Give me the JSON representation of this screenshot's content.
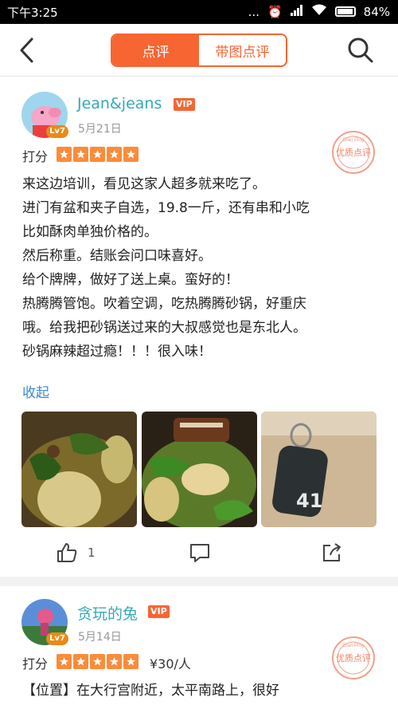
{
  "status": {
    "time": "下午3:25",
    "dots": "...",
    "battery": "84%"
  },
  "nav": {
    "tabs": [
      {
        "label": "点评"
      },
      {
        "label": "带图点评"
      }
    ]
  },
  "reviews": [
    {
      "username": "Jean&jeans",
      "vip": "VIP",
      "level": "Lv7",
      "date": "5月21日",
      "score_label": "打分",
      "stars": 5,
      "lines": [
        "来这边培训，看见这家人超多就来吃了。",
        "进门有盆和夹子自选，19.8一斤，还有串和小吃",
        "比如酥肉单独价格的。",
        "然后称重。结账会问口味喜好。",
        "给个牌牌，做好了送上桌。蛮好的！",
        "热腾腾管饱。吹着空调，吃热腾腾砂锅，好重庆",
        "哦。给我把砂锅送过来的大叔感觉也是东北人。",
        "砂锅麻辣超过瘾！！！很入味！"
      ],
      "collapse": "收起",
      "likes": "1",
      "stamp_text": "优质点评",
      "stamp_en": "Dian Ping",
      "photo_tag": "41"
    },
    {
      "username": "贪玩的兔",
      "vip": "VIP",
      "level": "Lv7",
      "date": "5月14日",
      "score_label": "打分",
      "stars": 5,
      "price": "¥30/人",
      "lines": [
        "【位置】在大行宫附近，太平南路上，很好"
      ],
      "stamp_text": "优质点评",
      "stamp_en": "Dian Ping"
    }
  ],
  "colors": {
    "accent": "#f76532",
    "link": "#3a8ad0",
    "username": "#34a9b8",
    "star": "#fb8c3a"
  }
}
